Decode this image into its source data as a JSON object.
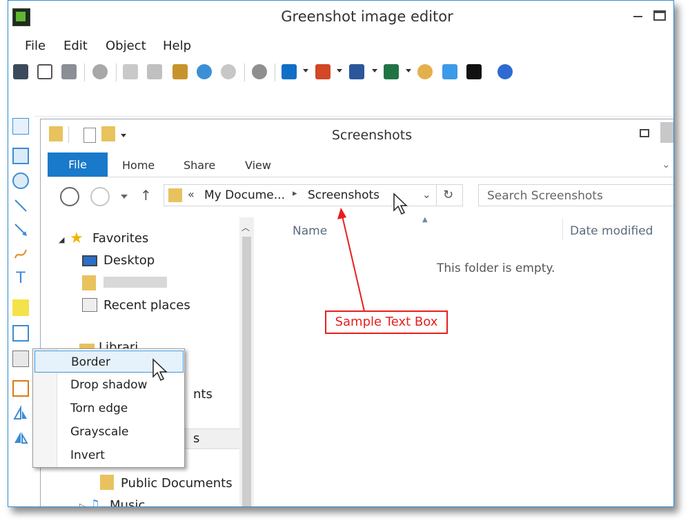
{
  "window": {
    "title": "Greenshot image editor"
  },
  "menubar": [
    "File",
    "Edit",
    "Object",
    "Help"
  ],
  "toolbar_icons": [
    "save-icon",
    "clipboard-icon",
    "print-icon",
    "delete-icon",
    "cut-icon",
    "copy-icon",
    "paste-icon",
    "undo-icon",
    "redo-icon",
    "settings-icon",
    "outlook-icon",
    "powerpoint-icon",
    "word-icon",
    "excel-icon",
    "paint-icon",
    "dropbox-icon",
    "imgur-icon",
    "help-icon"
  ],
  "left_tools": [
    "cursor-icon",
    "rectangle-icon",
    "ellipse-icon",
    "line-icon",
    "arrow-icon",
    "freehand-icon",
    "text-icon",
    "highlight-icon",
    "obfuscate-icon",
    "effects-icon",
    "crop-icon",
    "rotate-icon",
    "flip-icon"
  ],
  "explorer": {
    "title": "Screenshots",
    "tabs": {
      "file": "File",
      "home": "Home",
      "share": "Share",
      "view": "View"
    },
    "address": {
      "chevrons": "«",
      "parent": "My Docume...",
      "separator": "▸",
      "current": "Screenshots"
    },
    "search_placeholder": "Search Screenshots",
    "nav": {
      "favorites": "Favorites",
      "desktop": "Desktop",
      "recent": "Recent places",
      "libraries_partial": "Librari",
      "documents_partial": "nts",
      "screenshots_partial": "s",
      "public_documents": "Public Documents",
      "music": "Music"
    },
    "columns": {
      "name": "Name",
      "date": "Date modified"
    },
    "empty_message": "This folder is empty."
  },
  "annotation": {
    "text_box": "Sample Text Box",
    "color": "#e81e1e"
  },
  "effects_menu": [
    "Border",
    "Drop shadow",
    "Torn edge",
    "Grayscale",
    "Invert"
  ],
  "colors": {
    "accent": "#1979ca",
    "highlight": "#e5f1fb",
    "highlight_border": "#3a97dd"
  }
}
